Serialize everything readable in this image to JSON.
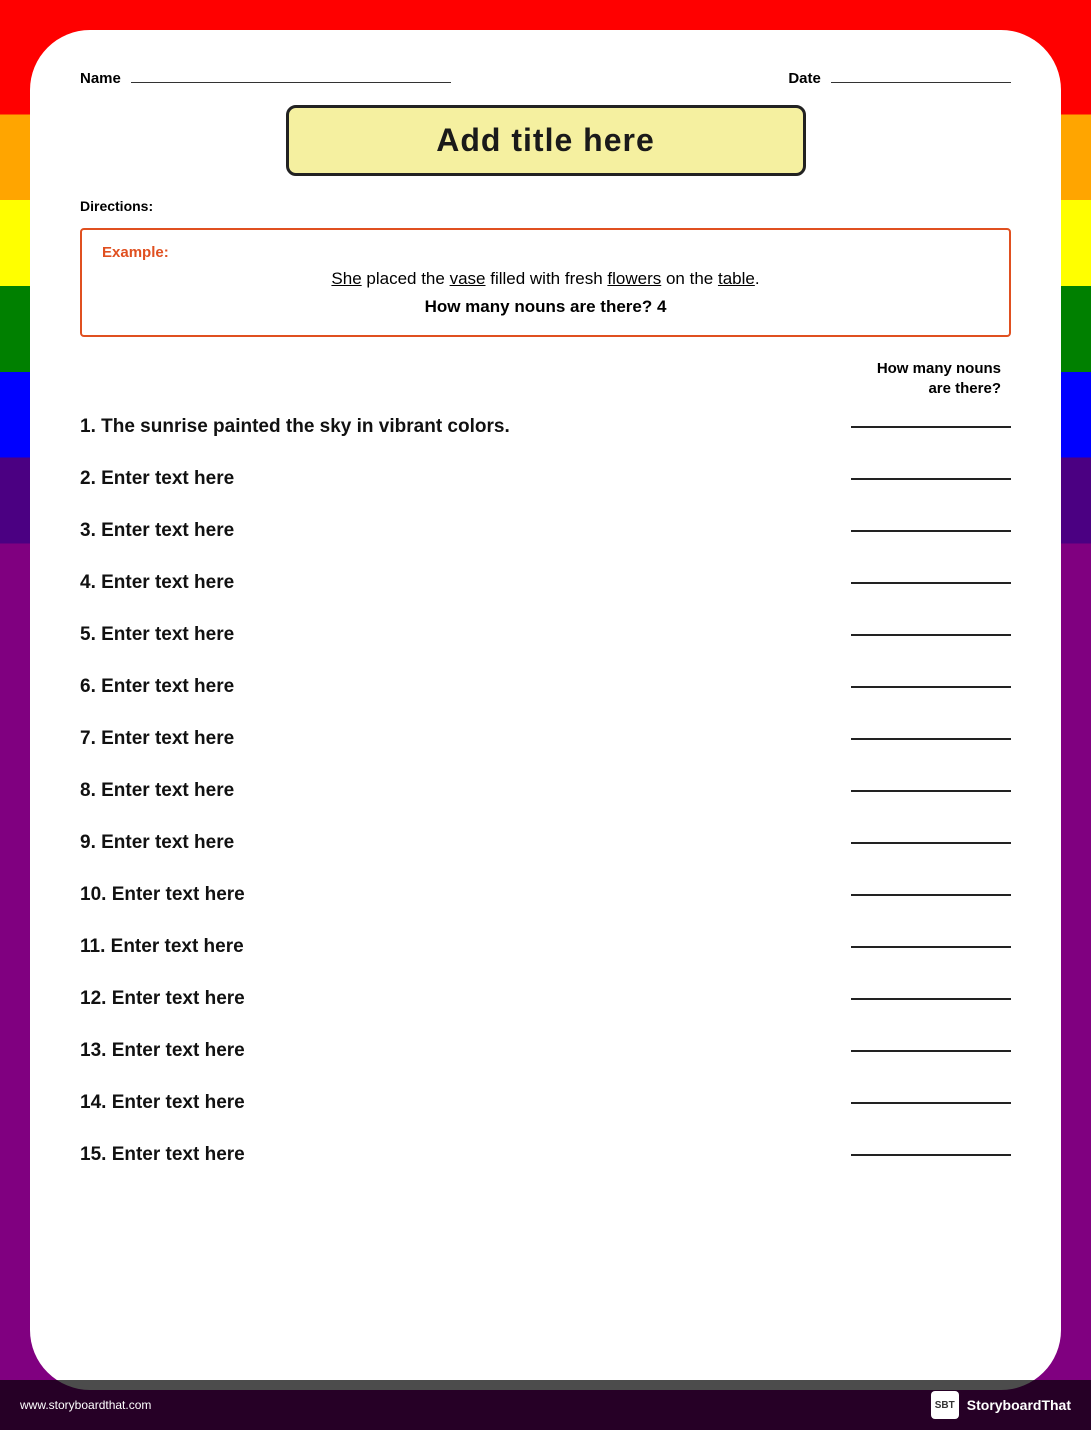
{
  "page": {
    "title": "Add title here",
    "name_label": "Name",
    "date_label": "Date",
    "directions_label": "Directions:",
    "example_label": "Example:",
    "example_sentence": "She placed the vase filled with fresh flowers on the table.",
    "example_question": "How many nouns are there? 4",
    "column_header": "How many nouns\nare there?",
    "underlined_words": [
      "She",
      "vase",
      "flowers",
      "table"
    ],
    "items": [
      {
        "number": "1.",
        "text": "The sunrise painted the sky in vibrant colors."
      },
      {
        "number": "2.",
        "text": "Enter text here"
      },
      {
        "number": "3.",
        "text": "Enter text here"
      },
      {
        "number": "4.",
        "text": "Enter text here"
      },
      {
        "number": "5.",
        "text": "Enter text here"
      },
      {
        "number": "6.",
        "text": "Enter text here"
      },
      {
        "number": "7.",
        "text": "Enter text here"
      },
      {
        "number": "8.",
        "text": "Enter text here"
      },
      {
        "number": "9.",
        "text": "Enter text here"
      },
      {
        "number": "10.",
        "text": "Enter text here"
      },
      {
        "number": "11.",
        "text": "Enter text here"
      },
      {
        "number": "12.",
        "text": "Enter text here"
      },
      {
        "number": "13.",
        "text": "Enter text here"
      },
      {
        "number": "14.",
        "text": "Enter text here"
      },
      {
        "number": "15.",
        "text": "Enter text here"
      }
    ],
    "footer": {
      "url": "www.storyboardthat.com",
      "logo": "StoryboardThat"
    }
  }
}
